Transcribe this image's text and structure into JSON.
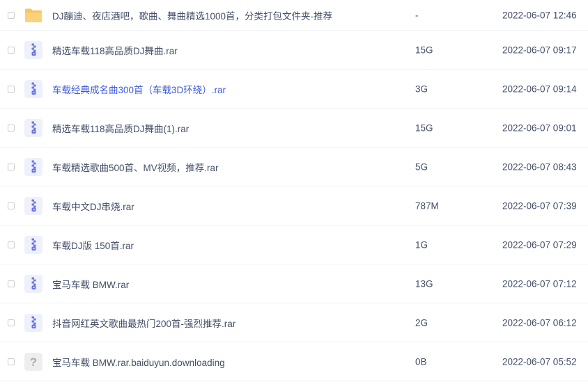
{
  "files": [
    {
      "name": "DJ蹦迪、夜店酒吧，歌曲、舞曲精选1000首，分类打包文件夹-推荐",
      "size": "-",
      "modified": "2022-06-07 12:46",
      "icon": "folder-icon",
      "link": false
    },
    {
      "name": "精选车载118高品质DJ舞曲.rar",
      "size": "15G",
      "modified": "2022-06-07 09:17",
      "icon": "archive-icon",
      "link": false
    },
    {
      "name": "车载经典成名曲300首（车载3D环绕）.rar",
      "size": "3G",
      "modified": "2022-06-07 09:14",
      "icon": "archive-icon",
      "link": true
    },
    {
      "name": "精选车载118高品质DJ舞曲(1).rar",
      "size": "15G",
      "modified": "2022-06-07 09:01",
      "icon": "archive-icon",
      "link": false
    },
    {
      "name": "车载精选歌曲500首、MV视频，推荐.rar",
      "size": "5G",
      "modified": "2022-06-07 08:43",
      "icon": "archive-icon",
      "link": false
    },
    {
      "name": "车载中文DJ串烧.rar",
      "size": "787M",
      "modified": "2022-06-07 07:39",
      "icon": "archive-icon",
      "link": false
    },
    {
      "name": "车载DJ版 150首.rar",
      "size": "1G",
      "modified": "2022-06-07 07:29",
      "icon": "archive-icon",
      "link": false
    },
    {
      "name": "宝马车载 BMW.rar",
      "size": "13G",
      "modified": "2022-06-07 07:12",
      "icon": "archive-icon",
      "link": false
    },
    {
      "name": "抖音网红英文歌曲最热门200首-强烈推荐.rar",
      "size": "2G",
      "modified": "2022-06-07 06:12",
      "icon": "archive-icon",
      "link": false
    },
    {
      "name": "宝马车载 BMW.rar.baiduyun.downloading",
      "size": "0B",
      "modified": "2022-06-07 05:52",
      "icon": "unknown-file-icon",
      "link": false
    }
  ],
  "colors": {
    "text": "#424e67",
    "link": "#3b5bdb",
    "folder": "#f7c45e",
    "archive_bg": "#eef0fb",
    "archive_zip": "#6a74e6",
    "unknown_bg": "#eeeeee",
    "unknown_mark": "#aaaaaa"
  }
}
